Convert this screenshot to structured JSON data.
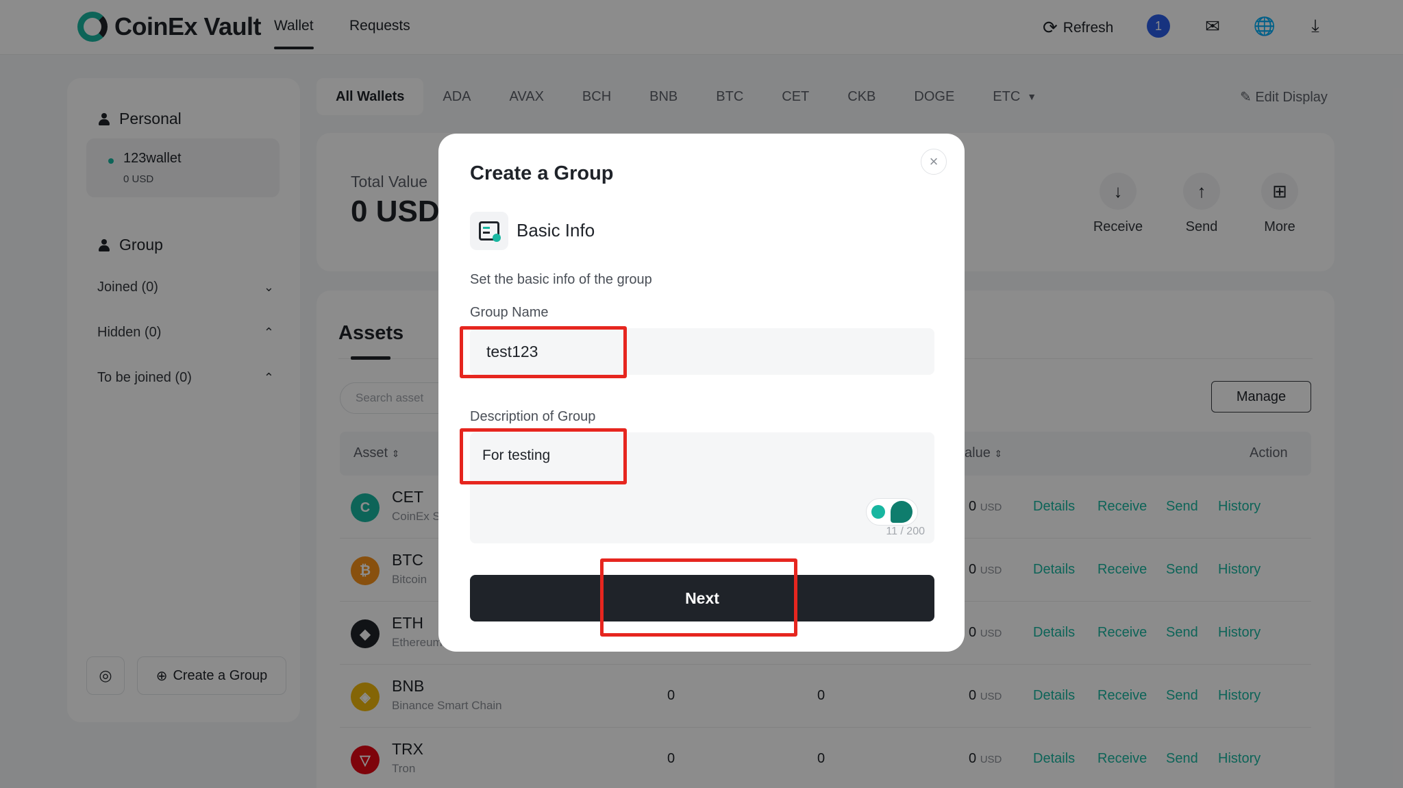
{
  "header": {
    "brand": "CoinEx Vault",
    "tabs": [
      {
        "label": "Wallet",
        "active": true
      },
      {
        "label": "Requests",
        "active": false
      }
    ],
    "refresh_label": "Refresh",
    "notification_count": "1",
    "icons": [
      "mail-icon",
      "globe-icon",
      "download-icon"
    ]
  },
  "sidebar": {
    "personal_title": "Personal",
    "wallet": {
      "name": "123wallet",
      "value": "0 USD"
    },
    "group_title": "Group",
    "group_items": [
      {
        "label": "Joined (0)",
        "chevron": "down"
      },
      {
        "label": "Hidden (0)",
        "chevron": "up"
      },
      {
        "label": "To be joined (0)",
        "chevron": "up"
      }
    ],
    "create_group_label": "Create a Group"
  },
  "coin_tabs": [
    "All Wallets",
    "ADA",
    "AVAX",
    "BCH",
    "BNB",
    "BTC",
    "CET",
    "CKB",
    "DOGE",
    "ETC"
  ],
  "edit_display_label": "Edit Display",
  "total": {
    "label": "Total Value",
    "value": "0 USD",
    "actions": [
      {
        "label": "Receive",
        "icon": "arrow-down-icon"
      },
      {
        "label": "Send",
        "icon": "arrow-up-icon"
      },
      {
        "label": "More",
        "icon": "grid-icon"
      }
    ]
  },
  "assets": {
    "title": "Assets",
    "search_placeholder": "Search asset",
    "manage_label": "Manage",
    "columns": {
      "asset": "Asset",
      "value": "alue",
      "action": "Action"
    },
    "rows": [
      {
        "symbol": "CET",
        "name": "CoinEx S",
        "col2": "",
        "col3": "",
        "value": "0",
        "unit": "USD",
        "color": "#18b6a0"
      },
      {
        "symbol": "BTC",
        "name": "Bitcoin",
        "col2": "",
        "col3": "",
        "value": "0",
        "unit": "USD",
        "color": "#f7931a"
      },
      {
        "symbol": "ETH",
        "name": "Ethereum",
        "col2": "",
        "col3": "",
        "value": "0",
        "unit": "USD",
        "color": "#1f2329"
      },
      {
        "symbol": "BNB",
        "name": "Binance Smart Chain",
        "col2": "0",
        "col3": "0",
        "value": "0",
        "unit": "USD",
        "color": "#f0b90b"
      },
      {
        "symbol": "TRX",
        "name": "Tron",
        "col2": "0",
        "col3": "0",
        "value": "0",
        "unit": "USD",
        "color": "#e50915"
      }
    ],
    "row_actions": [
      "Details",
      "Receive",
      "Send",
      "History"
    ]
  },
  "modal": {
    "title": "Create a Group",
    "section_title": "Basic Info",
    "section_desc": "Set the basic info of the group",
    "group_name_label": "Group Name",
    "group_name_value": "test123",
    "description_label": "Description of Group",
    "description_value": "For testing",
    "char_count": "11 / 200",
    "next_label": "Next"
  },
  "colors": {
    "accent": "#18b6a0",
    "dark": "#1f2329",
    "annotation": "#e6261f"
  }
}
